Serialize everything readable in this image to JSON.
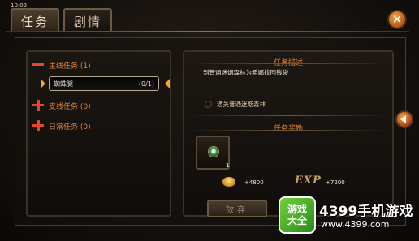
{
  "status": {
    "time": "10:02"
  },
  "tabs": [
    {
      "label": "任务",
      "active": true
    },
    {
      "label": "剧情",
      "active": false
    }
  ],
  "close_icon": "close-x-icon",
  "quest_list": {
    "categories": [
      {
        "label": "主线任务 (1)",
        "expanded": true,
        "icon": "minus-icon"
      },
      {
        "label": "支线任务 (0)",
        "expanded": false,
        "icon": "plus-icon"
      },
      {
        "label": "日常任务 (0)",
        "expanded": false,
        "icon": "plus-icon"
      }
    ],
    "selected_quest": {
      "name": "蜘蛛腿",
      "progress": "(0/1)"
    }
  },
  "details": {
    "description_title": "任务描述",
    "description_text": "到普通迷烟森林为希娜找回钱袋",
    "objective": "通关普通迷烟森林",
    "reward_title": "任务奖励",
    "reward_item_count": "1",
    "gold_reward": "+4800",
    "exp_label": "EXP",
    "exp_reward": "+7200",
    "abandon_label": "放弃"
  },
  "watermark": {
    "badge_line1": "游戏",
    "badge_line2": "大全",
    "brand": "4399手机游戏",
    "url": "www.4399.com"
  },
  "colors": {
    "accent_orange": "#e0843a",
    "text_light": "#ece3d3",
    "icon_red": "#e5472c"
  }
}
